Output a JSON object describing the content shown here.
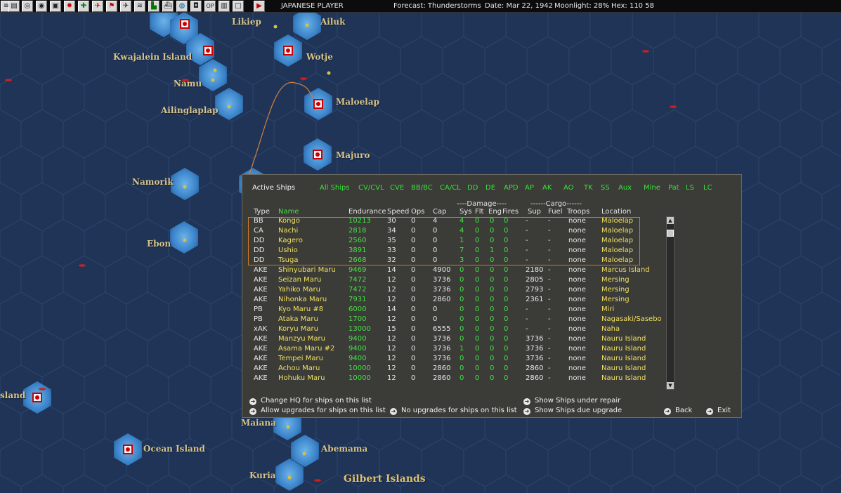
{
  "toolbar": {
    "player": "JAPANESE PLAYER",
    "forecast": "Forecast: Thunderstorms",
    "date": "Date: Mar 22, 1942",
    "moonlight": "Moonlight: 28%",
    "hex": "Hex: 110 58"
  },
  "map": {
    "labels": {
      "likiep": "Likiep",
      "ailuk": "Ailuk",
      "kwajalein": "Kwajalein Island",
      "wotje": "Wotje",
      "namu": "Namu",
      "maloelap": "Maloelap",
      "ailinglaplap": "Ailinglaplap",
      "majuro": "Majuro",
      "namorik": "Namorik",
      "ebon": "Ebon",
      "island_left": "sland",
      "maiana": "Maiana",
      "ocean_island": "Ocean Island",
      "abemama": "Abemama",
      "kuria": "Kuria",
      "gilbert": "Gilbert Islands"
    }
  },
  "dialog": {
    "title": "Active Ships",
    "filters": [
      "All Ships",
      "CV/CVL",
      "CVE",
      "BB/BC",
      "CA/CL",
      "DD",
      "DE",
      "APD",
      "AP",
      "AK",
      "AO",
      "TK",
      "SS",
      "Aux",
      "Mine",
      "Pat",
      "LS",
      "LC"
    ],
    "group_damage": "----Damage----",
    "group_cargo": "------Cargo------",
    "columns": {
      "type": "Type",
      "name": "Name",
      "endurance": "Endurance",
      "speed": "Speed",
      "ops": "Ops",
      "cap": "Cap",
      "sys": "Sys",
      "flt": "Flt",
      "eng": "Eng",
      "fires": "Fires",
      "sup": "Sup",
      "fuel": "Fuel",
      "troops": "Troops",
      "location": "Location"
    },
    "rows": [
      [
        "BB",
        "Kongo",
        "10213",
        "30",
        "0",
        "4",
        "4",
        "0",
        "0",
        "0",
        "-",
        "-",
        "none",
        "Maloelap"
      ],
      [
        "CA",
        "Nachi",
        "2818",
        "34",
        "0",
        "0",
        "4",
        "0",
        "0",
        "0",
        "-",
        "-",
        "none",
        "Maloelap"
      ],
      [
        "DD",
        "Kagero",
        "2560",
        "35",
        "0",
        "0",
        "1",
        "0",
        "0",
        "0",
        "-",
        "-",
        "none",
        "Maloelap"
      ],
      [
        "DD",
        "Ushio",
        "3891",
        "33",
        "0",
        "0",
        "7",
        "0",
        "1",
        "0",
        "-",
        "-",
        "none",
        "Maloelap"
      ],
      [
        "DD",
        "Tsuga",
        "2668",
        "32",
        "0",
        "0",
        "3",
        "0",
        "0",
        "0",
        "-",
        "-",
        "none",
        "Maloelap"
      ],
      [
        "AKE",
        "Shinyubari Maru",
        "9469",
        "14",
        "0",
        "4900",
        "0",
        "0",
        "0",
        "0",
        "2180",
        "-",
        "none",
        "Marcus Island"
      ],
      [
        "AKE",
        "Seizan Maru",
        "7472",
        "12",
        "0",
        "3736",
        "0",
        "0",
        "0",
        "0",
        "2805",
        "-",
        "none",
        "Mersing"
      ],
      [
        "AKE",
        "Yahiko Maru",
        "7472",
        "12",
        "0",
        "3736",
        "0",
        "0",
        "0",
        "0",
        "2793",
        "-",
        "none",
        "Mersing"
      ],
      [
        "AKE",
        "Nihonka Maru",
        "7931",
        "12",
        "0",
        "2860",
        "0",
        "0",
        "0",
        "0",
        "2361",
        "-",
        "none",
        "Mersing"
      ],
      [
        "PB",
        "Kyo Maru #8",
        "6000",
        "14",
        "0",
        "0",
        "0",
        "0",
        "0",
        "0",
        "-",
        "-",
        "none",
        "Miri"
      ],
      [
        "PB",
        "Ataka Maru",
        "1700",
        "12",
        "0",
        "0",
        "0",
        "0",
        "0",
        "0",
        "-",
        "-",
        "none",
        "Nagasaki/Sasebo"
      ],
      [
        "xAK",
        "Koryu Maru",
        "13000",
        "15",
        "0",
        "6555",
        "0",
        "0",
        "0",
        "0",
        "-",
        "-",
        "none",
        "Naha"
      ],
      [
        "AKE",
        "Manzyu Maru",
        "9400",
        "12",
        "0",
        "3736",
        "0",
        "0",
        "0",
        "0",
        "3736",
        "-",
        "none",
        "Nauru Island"
      ],
      [
        "AKE",
        "Asama Maru #2",
        "9400",
        "12",
        "0",
        "3736",
        "1",
        "0",
        "0",
        "0",
        "3736",
        "-",
        "none",
        "Nauru Island"
      ],
      [
        "AKE",
        "Tempei Maru",
        "9400",
        "12",
        "0",
        "3736",
        "0",
        "0",
        "0",
        "0",
        "3736",
        "-",
        "none",
        "Nauru Island"
      ],
      [
        "AKE",
        "Achou Maru",
        "10000",
        "12",
        "0",
        "2860",
        "0",
        "0",
        "0",
        "0",
        "2860",
        "-",
        "none",
        "Nauru Island"
      ],
      [
        "AKE",
        "Hohuku Maru",
        "10000",
        "12",
        "0",
        "2860",
        "0",
        "0",
        "0",
        "0",
        "2860",
        "-",
        "none",
        "Nauru Island"
      ]
    ],
    "options": {
      "change_hq": "Change HQ for ships on this list",
      "allow_upgrades": "Allow upgrades for ships on this list",
      "no_upgrades": "No upgrades for ships on this list",
      "show_repair": "Show Ships under repair",
      "show_upgrade": "Show Ships due upgrade",
      "back": "Back",
      "exit": "Exit"
    }
  },
  "colors": {
    "ocean": "#1f3456",
    "hex_line": "#2e4a72",
    "shallow": "#3a82c8",
    "dialog_bg": "#3b3b38",
    "green": "#46e046",
    "yellow": "#f0e060",
    "selection": "#d07a2a"
  }
}
